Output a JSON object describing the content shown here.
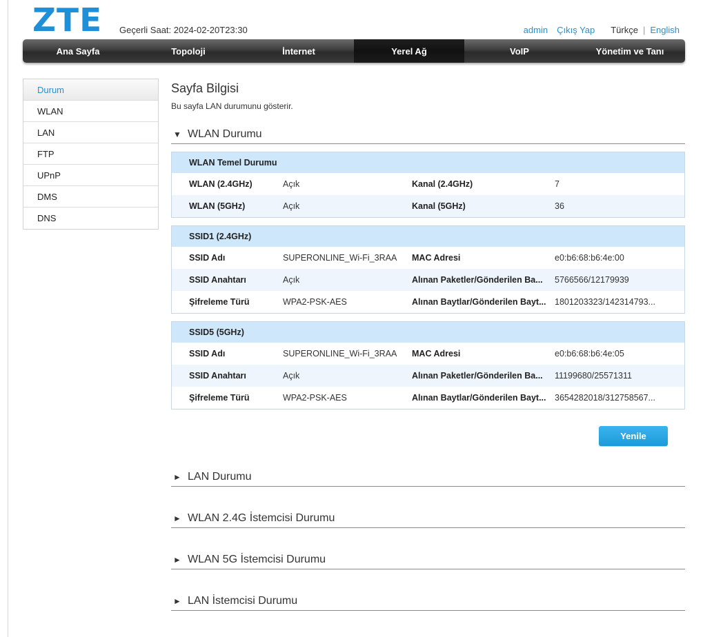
{
  "header": {
    "logo": "ZTE",
    "clock": "Geçerli Saat: 2024-02-20T23:30",
    "user": "admin",
    "logout": "Çıkış Yap",
    "lang_current": "Türkçe",
    "lang_separator": "|",
    "lang_other": "English"
  },
  "nav": {
    "items": [
      "Ana Sayfa",
      "Topoloji",
      "İnternet",
      "Yerel Ağ",
      "VoIP",
      "Yönetim ve Tanı"
    ],
    "active_index": 3
  },
  "sidebar": {
    "items": [
      "Durum",
      "WLAN",
      "LAN",
      "FTP",
      "UPnP",
      "DMS",
      "DNS"
    ],
    "active_index": 0
  },
  "main": {
    "title": "Sayfa Bilgisi",
    "description": "Bu sayfa LAN durumunu gösterir.",
    "wlan_section": {
      "label": "WLAN Durumu",
      "expanded_icon": "▼",
      "boxes": [
        {
          "title": "WLAN Temel Durumu",
          "rows": [
            [
              "WLAN (2.4GHz)",
              "Açık",
              "Kanal (2.4GHz)",
              "7"
            ],
            [
              "WLAN (5GHz)",
              "Açık",
              "Kanal (5GHz)",
              "36"
            ]
          ]
        },
        {
          "title": "SSID1 (2.4GHz)",
          "rows": [
            [
              "SSID Adı",
              "SUPERONLINE_Wi-Fi_3RAA",
              "MAC Adresi",
              "e0:b6:68:b6:4e:00"
            ],
            [
              "SSID Anahtarı",
              "Açık",
              "Alınan Paketler/Gönderilen Ba...",
              "5766566/12179939"
            ],
            [
              "Şifreleme Türü",
              "WPA2-PSK-AES",
              "Alınan Baytlar/Gönderilen Bayt...",
              "1801203323/142314793..."
            ]
          ]
        },
        {
          "title": "SSID5 (5GHz)",
          "rows": [
            [
              "SSID Adı",
              "SUPERONLINE_Wi-Fi_3RAA",
              "MAC Adresi",
              "e0:b6:68:b6:4e:05"
            ],
            [
              "SSID Anahtarı",
              "Açık",
              "Alınan Paketler/Gönderilen Ba...",
              "11199680/25571311"
            ],
            [
              "Şifreleme Türü",
              "WPA2-PSK-AES",
              "Alınan Baytlar/Gönderilen Bayt...",
              "3654282018/312758567..."
            ]
          ]
        }
      ],
      "refresh_label": "Yenile"
    },
    "collapsed_icon": "►",
    "collapsed_sections": [
      "LAN Durumu",
      "WLAN 2.4G İstemcisi Durumu",
      "WLAN 5G İstemcisi Durumu",
      "LAN İstemcisi Durumu"
    ]
  }
}
